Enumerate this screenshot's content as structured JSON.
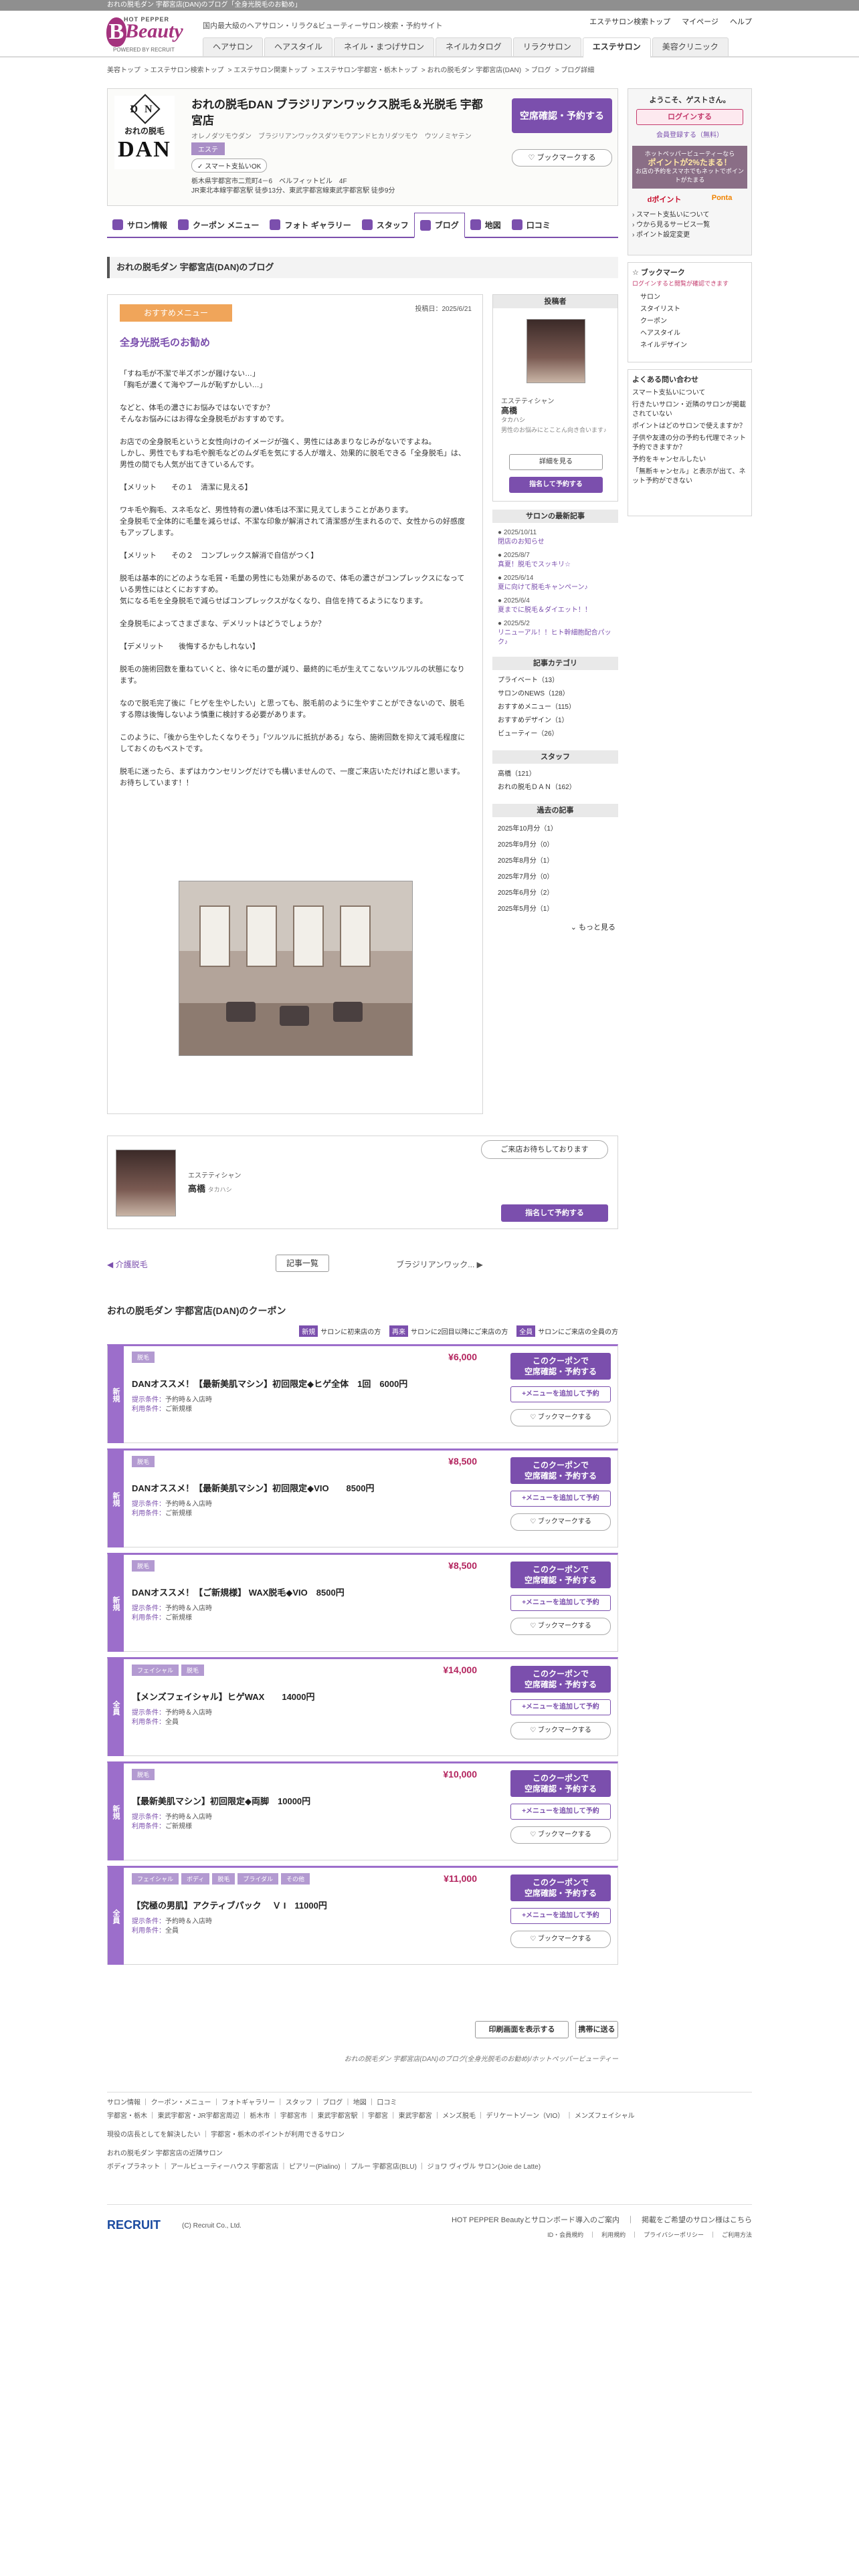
{
  "topbar": {
    "text": "おれの脱毛ダン 宇都宮店(DAN)のブログ「全身光脱毛のお勧め」"
  },
  "header": {
    "logo_hp": "HOT PEPPER",
    "logo_beauty": "Beauty",
    "logo_b": "B",
    "logo_powered": "POWERED BY RECRUIT",
    "tagline": "国内最大級のヘアサロン・リラク&ビューティーサロン検索・予約サイト",
    "links": [
      "エステサロン検索トップ",
      "マイページ",
      "ヘルプ"
    ],
    "nav": [
      "ヘアサロン",
      "ヘアスタイル",
      "ネイル・まつげサロン",
      "ネイルカタログ",
      "リラクサロン",
      "エステサロン",
      "美容クリニック"
    ],
    "active_nav": "エステサロン"
  },
  "breadcrumb": [
    "美容トップ",
    "エステサロン検索トップ",
    "エステサロン関東トップ",
    "エステサロン宇都宮・栃木トップ",
    "おれの脱毛ダン 宇都宮店(DAN)",
    "ブログ",
    "ブログ詳細"
  ],
  "shop": {
    "logo_dn": "DN",
    "logo_text": "おれの脱毛",
    "logo_dan": "DAN",
    "name": "おれの脱毛DAN ブラジリアンワックス脱毛＆光脱毛 宇都宮店",
    "kana": "オレノダツモウダン　ブラジリアンワックスダツモウアンドヒカリダツモウ　ウツノミヤテン",
    "genre": "エステ",
    "pill": "スマート支払いOK",
    "address": "栃木県宇都宮市二荒町4－6　ベルフィットビル　4F",
    "access": "JR東北本線宇都宮駅 徒歩13分、東武宇都宮線東武宇都宮駅 徒歩9分",
    "reserve_btn": "空席確認・予約する",
    "bookmark_btn": "ブックマークする"
  },
  "tabs": [
    {
      "label": "サロン情報"
    },
    {
      "label": "クーポン メニュー"
    },
    {
      "label": "フォト ギャラリー"
    },
    {
      "label": "スタッフ"
    },
    {
      "label": "ブログ"
    },
    {
      "label": "地図"
    },
    {
      "label": "口コミ"
    }
  ],
  "blog_title": "おれの脱毛ダン 宇都宮店(DAN)のブログ",
  "article": {
    "category": "おすすめメニュー",
    "posted": "投稿日：2025/6/21",
    "title": "全身光脱毛のお勧め",
    "paragraphs": [
      "「すね毛が不潔で半ズボンが履けない…」\n「胸毛が濃くて海やプールが恥ずかしい…」",
      "などと、体毛の濃さにお悩みではないですか？\nそんなお悩みにはお得な全身脱毛がおすすめです。",
      "お店での全身脱毛というと女性向けのイメージが強く、男性にはあまりなじみがないですよね。\nしかし、男性でもすね毛や腕毛などのムダ毛を気にする人が増え、効果的に脱毛できる「全身脱毛」は、男性の間でも人気が出てきているんです。",
      "【メリット　　その１　清潔に見える】",
      "ワキ毛や胸毛、スネ毛など、男性特有の濃い体毛は不潔に見えてしまうことがあります。\n全身脱毛で全体的に毛量を減らせば、不潔な印象が解消されて清潔感が生まれるので、女性からの好感度もアップします。",
      "【メリット　　その２　コンプレックス解消で自信がつく】",
      "脱毛は基本的にどのような毛質・毛量の男性にも効果があるので、体毛の濃さがコンプレックスになっている男性にはとくにおすすめ。\n気になる毛を全身脱毛で減らせばコンプレックスがなくなり、自信を持てるようになります。",
      "全身脱毛によってさまざまな、デメリットはどうでしょうか？",
      "【デメリット　　後悔するかもしれない】",
      "脱毛の施術回数を重ねていくと、徐々に毛の量が減り、最終的に毛が生えてこないツルツルの状態になります。",
      "なので脱毛完了後に「ヒゲを生やしたい」と思っても、脱毛前のように生やすことができないので、脱毛する際は後悔しないよう慎重に検討する必要があります。",
      "このように、「後から生やしたくなりそう」「ツルツルに抵抗がある」なら、施術回数を抑えて減毛程度にしておくのもベストです。",
      "脱毛に迷ったら、まずはカウンセリングだけでも構いませんので、一度ご来店いただければと思います。お待ちしています！！"
    ]
  },
  "poster": {
    "heading": "投稿者",
    "role": "エステティシャン",
    "name": "高橋",
    "kana": "タカハシ",
    "desc": "男性のお悩みにとことん向き合います♪",
    "detail_btn": "詳細を見る",
    "reserve_btn": "指名して予約する"
  },
  "latest": {
    "heading": "サロンの最新記事",
    "items": [
      {
        "date": "2025/10/11",
        "title": "閉店のお知らせ"
      },
      {
        "date": "2025/8/7",
        "title": "真夏！脱毛でスッキリ☆"
      },
      {
        "date": "2025/6/14",
        "title": "夏に向けて脱毛キャンペーン♪"
      },
      {
        "date": "2025/6/4",
        "title": "夏までに脱毛＆ダイエット！！"
      },
      {
        "date": "2025/5/2",
        "title": "リニューアル！！ヒト幹細胞配合パック♪"
      }
    ]
  },
  "categories": {
    "heading": "記事カテゴリ",
    "items": [
      "プライベート（13）",
      "サロンのNEWS（128）",
      "おすすめメニュー（115）",
      "おすすめデザイン（1）",
      "ビューティー（26）"
    ]
  },
  "staff_list": {
    "heading": "スタッフ",
    "items": [
      "高橋（121）",
      "おれの脱毛ＤＡＮ（162）"
    ]
  },
  "archive": {
    "heading": "過去の記事",
    "items": [
      "2025年10月分（1）",
      "2025年9月分（0）",
      "2025年8月分（1）",
      "2025年7月分（0）",
      "2025年6月分（2）",
      "2025年5月分（1）"
    ],
    "more": "もっと見る"
  },
  "rside": {
    "welcome": "ようこそ、ゲストさん。",
    "login": "ログインする",
    "register": "会員登録する（無料）",
    "promo1": "ホットペッパービューティーなら",
    "promo2": "ポイントが2%たまる！",
    "promo3": "お店の予約をスマホでもネットでポイントがたまる",
    "dpoint": "dポイント",
    "ponta": "Ponta",
    "links": [
      "スマート支払いについて",
      "ウから見るサービス一覧",
      "ポイント設定変更"
    ],
    "bm_heading": "ブックマーク",
    "bm_note": "ログインすると閲覧が確認できます",
    "bm_items": [
      "サロン",
      "スタイリスト",
      "クーポン",
      "ヘアスタイル",
      "ネイルデザイン"
    ],
    "faq_heading": "よくある問い合わせ",
    "faq": [
      "スマート支払いについて",
      "行きたいサロン・近隣のサロンが掲載されていない",
      "ポイントはどのサロンで使えますか？",
      "子供や友達の分の予約も代理でネット予約できますか？",
      "予約をキャンセルしたい",
      "「無断キャンセル」と表示が出て、ネット予約ができない"
    ]
  },
  "stylist_card": {
    "bubble": "ご来店お待ちしております",
    "role": "エステティシャン",
    "name": "高橋",
    "kana": "タカハシ",
    "btn": "指名して予約する"
  },
  "pager": {
    "prev": "◀ 介護脱毛",
    "list": "記事一覧",
    "next": "ブラジリアンワック... ▶"
  },
  "coupons_heading": "おれの脱毛ダン 宇都宮店(DAN)のクーポン",
  "legend": [
    {
      "tag": "新規",
      "text": "サロンに初来店の方"
    },
    {
      "tag": "再来",
      "text": "サロンに2回目以降にご来店の方"
    },
    {
      "tag": "全員",
      "text": "サロンにご来店の全員の方"
    }
  ],
  "coupon_labels": {
    "present": "提示条件：",
    "use": "利用条件：",
    "btn1": "このクーポンで\n空席確認・予約する",
    "btn2": "+メニューを追加して予約",
    "btn3": "ブックマークする"
  },
  "coupons": [
    {
      "type": "新規",
      "tags": [
        "脱毛"
      ],
      "price": "¥6,000",
      "title": "DANオススメ！【最新美肌マシン】初回限定◆ヒゲ全体　1回　6000円",
      "present": "予約時＆入店時",
      "use": "ご新規様"
    },
    {
      "type": "新規",
      "tags": [
        "脱毛"
      ],
      "price": "¥8,500",
      "title": "DANオススメ！【最新美肌マシン】初回限定◆VIO　　8500円",
      "present": "予約時＆入店時",
      "use": "ご新規様"
    },
    {
      "type": "新規",
      "tags": [
        "脱毛"
      ],
      "price": "¥8,500",
      "title": "DANオススメ！【ご新規様】 WAX脱毛◆VIO　8500円",
      "present": "予約時＆入店時",
      "use": "ご新規様"
    },
    {
      "type": "全員",
      "tags": [
        "フェイシャル",
        "脱毛"
      ],
      "price": "¥14,000",
      "title": "【メンズフェイシャル】ヒゲWAX　　14000円",
      "present": "予約時＆入店時",
      "use": "全員"
    },
    {
      "type": "新規",
      "tags": [
        "脱毛"
      ],
      "price": "¥10,000",
      "title": "【最新美肌マシン】初回限定◆両脚　10000円",
      "present": "予約時＆入店時",
      "use": "ご新規様"
    },
    {
      "type": "全員",
      "tags": [
        "フェイシャル",
        "ボディ",
        "脱毛",
        "ブライダル",
        "その他"
      ],
      "price": "¥11,000",
      "title": "【究極の男肌】アクティブパック　 Ｖ I　11000円",
      "present": "予約時＆入店時",
      "use": "全員"
    }
  ],
  "print_btn": "印刷画面を表示する",
  "mobile_btn": "携帯に送る",
  "page_caption": "おれの脱毛ダン 宇都宮店(DAN)のブログ(全身光脱毛のお勧め)/ホットペッパービューティー",
  "footer": {
    "row1": [
      "サロン情報",
      "クーポン・メニュー",
      "フォトギャラリー",
      "スタッフ",
      "ブログ",
      "地図",
      "口コミ"
    ],
    "row2": [
      "宇都宮・栃木",
      "東武宇都宮・JR宇都宮周辺",
      "栃木市",
      "宇都宮市",
      "東武宇都宮駅",
      "宇都宮",
      "東武宇都宮",
      "メンズ脱毛",
      "デリケートゾーン（VIO）",
      "メンズフェイシャル"
    ],
    "row3": [
      "現役の店長としてを解決したい",
      "宇都宮・栃木のポイントが利用できるサロン"
    ],
    "row4": "おれの脱毛ダン 宇都宮店の近隣サロン",
    "row5": [
      "ボディプラネット",
      "アールビューティーハウス 宇都宮店",
      "ピアリー(Pialino)",
      "プルー 宇都宮店(BLU)",
      "ジョワ ヴィヴル サロン(Joie de Latte)"
    ],
    "recruit": "RECRUIT",
    "copyright": "(C) Recruit Co., Ltd.",
    "right1": "HOT PEPPER Beautyとサロンボード導入のご案内",
    "right2": "掲載をご希望のサロン様はこちら",
    "right3": [
      "ID・会員規約",
      "利用規約",
      "プライバシーポリシー",
      "ご利用方法"
    ]
  }
}
